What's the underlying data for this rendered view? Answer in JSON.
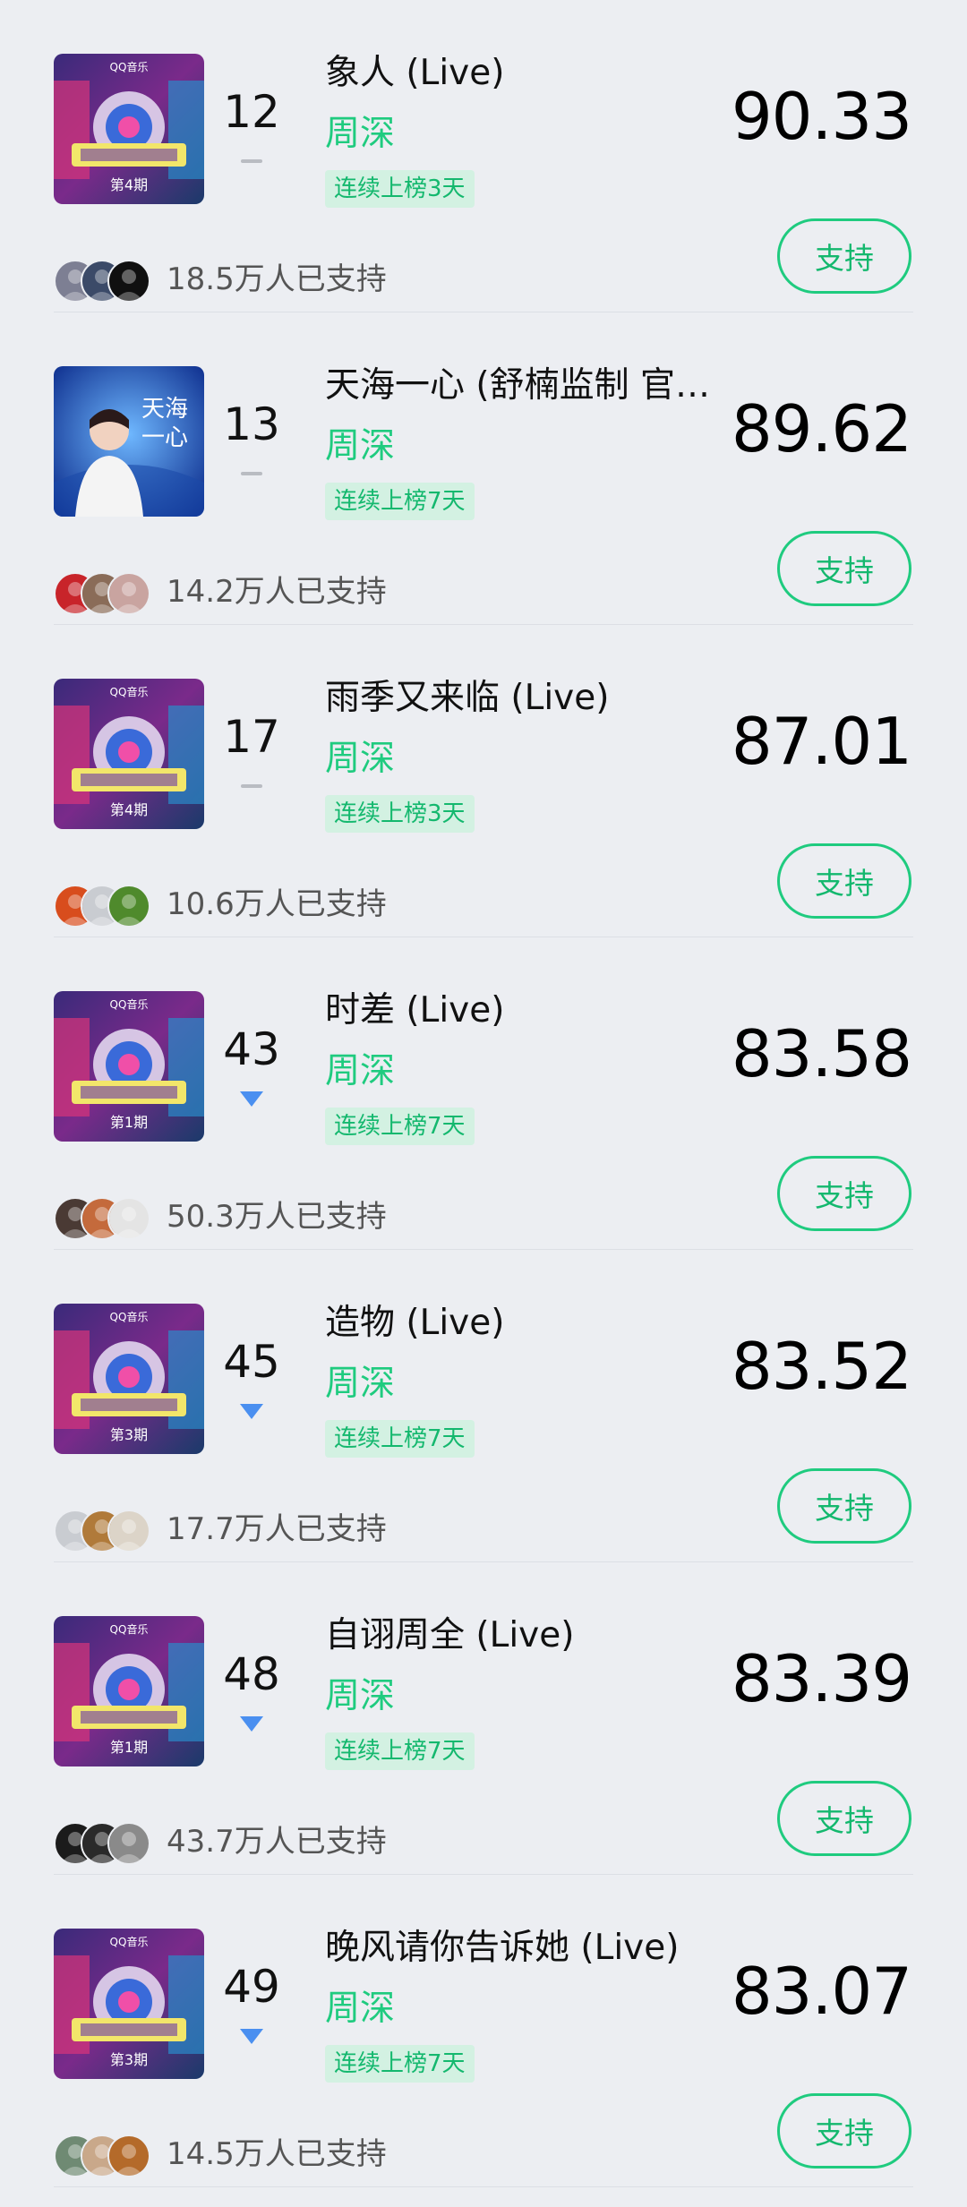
{
  "items": [
    {
      "rank": "12",
      "trend": "flat",
      "title": "象人 (Live)",
      "artist": "周深",
      "streak": "连续上榜3天",
      "score": "90.33",
      "supporters": "18.5万人已支持",
      "button": "支持",
      "cover": "variety",
      "cover_episode": "第4期",
      "avatar_colors": [
        "#7d7f93",
        "#3b4a68",
        "#101010"
      ]
    },
    {
      "rank": "13",
      "trend": "flat",
      "title": "天海一心 (舒楠监制 官…",
      "artist": "周深",
      "streak": "连续上榜7天",
      "score": "89.62",
      "supporters": "14.2万人已支持",
      "button": "支持",
      "cover": "portrait",
      "avatar_colors": [
        "#c8242a",
        "#8a6c58",
        "#c9a4a0"
      ]
    },
    {
      "rank": "17",
      "trend": "flat",
      "title": "雨季又来临 (Live)",
      "artist": "周深",
      "streak": "连续上榜3天",
      "score": "87.01",
      "supporters": "10.6万人已支持",
      "button": "支持",
      "cover": "variety",
      "cover_episode": "第4期",
      "avatar_colors": [
        "#d84d1d",
        "#c9ccd1",
        "#4f8a2c"
      ]
    },
    {
      "rank": "43",
      "trend": "down",
      "title": "时差 (Live)",
      "artist": "周深",
      "streak": "连续上榜7天",
      "score": "83.58",
      "supporters": "50.3万人已支持",
      "button": "支持",
      "cover": "variety",
      "cover_episode": "第1期",
      "avatar_colors": [
        "#4a3a34",
        "#c46a3c",
        "#e4e4e4"
      ]
    },
    {
      "rank": "45",
      "trend": "down",
      "title": "造物 (Live)",
      "artist": "周深",
      "streak": "连续上榜7天",
      "score": "83.52",
      "supporters": "17.7万人已支持",
      "button": "支持",
      "cover": "variety",
      "cover_episode": "第3期",
      "avatar_colors": [
        "#c9ccd1",
        "#b07a3a",
        "#dcd4c8"
      ]
    },
    {
      "rank": "48",
      "trend": "down",
      "title": "自诩周全 (Live)",
      "artist": "周深",
      "streak": "连续上榜7天",
      "score": "83.39",
      "supporters": "43.7万人已支持",
      "button": "支持",
      "cover": "variety",
      "cover_episode": "第1期",
      "avatar_colors": [
        "#1b1b1b",
        "#2a2a2a",
        "#8a8a8a"
      ]
    },
    {
      "rank": "49",
      "trend": "down",
      "title": "晚风请你告诉她 (Live)",
      "artist": "周深",
      "streak": "连续上榜7天",
      "score": "83.07",
      "supporters": "14.5万人已支持",
      "button": "支持",
      "cover": "variety",
      "cover_episode": "第3期",
      "avatar_colors": [
        "#6f8a73",
        "#c9a88a",
        "#b46a2a"
      ]
    }
  ],
  "cover_brand": "QQ音乐",
  "colors": {
    "accent": "#1fcb7f",
    "trend_down": "#4a8ff0",
    "background": "#eceef2"
  }
}
